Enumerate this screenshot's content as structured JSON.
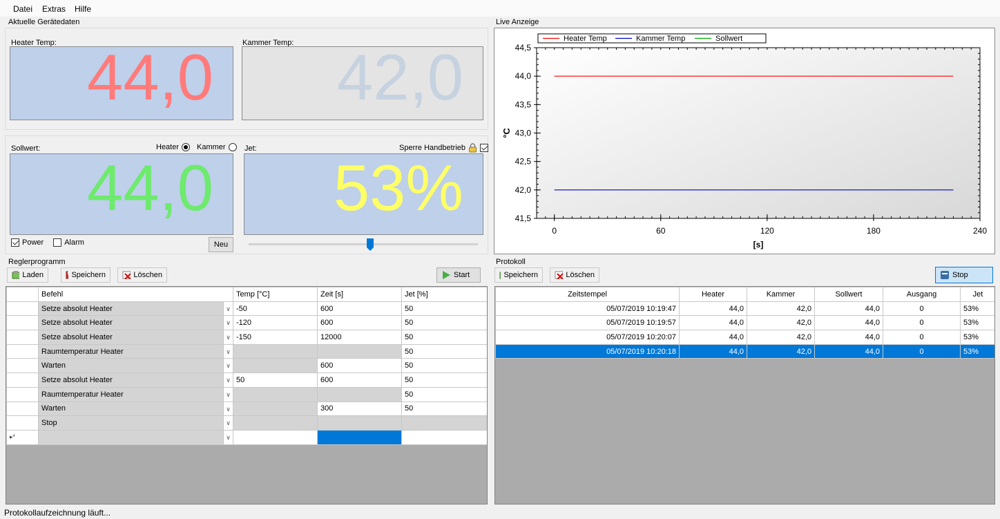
{
  "menu": [
    "Datei",
    "Extras",
    "Hilfe"
  ],
  "device": {
    "group_title": "Aktuelle Gerätedaten",
    "heater_label": "Heater Temp:",
    "heater_value": "44,0",
    "kammer_label": "Kammer Temp:",
    "kammer_value": "42,0",
    "sollwert_label": "Sollwert:",
    "sollwert_value": "44,0",
    "radio_heater": "Heater",
    "radio_kammer": "Kammer",
    "jet_label": "Jet:",
    "jet_value": "53%",
    "sperre_label": "Sperre Handbetrieb",
    "power_label": "Power",
    "alarm_label": "Alarm",
    "neu_label": "Neu",
    "jet_slider_value": 0.53
  },
  "colors": {
    "heater": "#ff7b7b",
    "kammer": "#c6d2e0",
    "sollwert": "#6eea6e",
    "jet": "#ffff66",
    "selection": "#0078d7"
  },
  "live": {
    "group_title": "Live Anzeige"
  },
  "chart_data": {
    "type": "line",
    "ylabel": "°C",
    "xlabel": "[s]",
    "ylim": [
      41.5,
      44.5
    ],
    "xlim": [
      -10,
      240
    ],
    "y_ticks": [
      "41,5",
      "42,0",
      "42,5",
      "43,0",
      "43,5",
      "44,0",
      "44,5"
    ],
    "x_ticks": [
      "0",
      "60",
      "120",
      "180",
      "240"
    ],
    "legend": "top-left",
    "series": [
      {
        "name": "Heater Temp",
        "color": "#ff0000",
        "x": [
          0,
          225
        ],
        "values": [
          44.0,
          44.0
        ]
      },
      {
        "name": "Kammer Temp",
        "color": "#0000cc",
        "x": [
          0,
          225
        ],
        "values": [
          42.0,
          42.0
        ]
      },
      {
        "name": "Sollwert",
        "color": "#00aa00",
        "x": [],
        "values": []
      }
    ]
  },
  "regler": {
    "group_title": "Reglerprogramm",
    "btn_laden": "Laden",
    "btn_speichern": "Speichern",
    "btn_loeschen": "Löschen",
    "btn_start": "Start",
    "columns": [
      "Befehl",
      "Temp [°C]",
      "Zeit [s]",
      "Jet [%]"
    ],
    "rows": [
      {
        "befehl": "Setze absolut Heater",
        "temp": "-50",
        "zeit": "600",
        "jet": "50"
      },
      {
        "befehl": "Setze absolut Heater",
        "temp": "-120",
        "zeit": "600",
        "jet": "50"
      },
      {
        "befehl": "Setze absolut Heater",
        "temp": "-150",
        "zeit": "12000",
        "jet": "50"
      },
      {
        "befehl": "Raumtemperatur Heater",
        "temp": "",
        "zeit": "",
        "jet": "50"
      },
      {
        "befehl": "Warten",
        "temp": "",
        "zeit": "600",
        "jet": "50"
      },
      {
        "befehl": "Setze absolut Heater",
        "temp": "50",
        "zeit": "600",
        "jet": "50"
      },
      {
        "befehl": "Raumtemperatur Heater",
        "temp": "",
        "zeit": "",
        "jet": "50"
      },
      {
        "befehl": "Warten",
        "temp": "",
        "zeit": "300",
        "jet": "50"
      },
      {
        "befehl": "Stop",
        "temp": "",
        "zeit": "",
        "jet": ""
      }
    ],
    "new_row_marker": "▸*"
  },
  "protokoll": {
    "group_title": "Protokoll",
    "btn_speichern": "Speichern",
    "btn_loeschen": "Löschen",
    "btn_stop": "Stop",
    "columns": [
      "Zeitstempel",
      "Heater",
      "Kammer",
      "Sollwert",
      "Ausgang",
      "Jet"
    ],
    "rows": [
      [
        "05/07/2019 10:19:47",
        "44,0",
        "42,0",
        "44,0",
        "0",
        "53%"
      ],
      [
        "05/07/2019 10:19:57",
        "44,0",
        "42,0",
        "44,0",
        "0",
        "53%"
      ],
      [
        "05/07/2019 10:20:07",
        "44,0",
        "42,0",
        "44,0",
        "0",
        "53%"
      ],
      [
        "05/07/2019 10:20:18",
        "44,0",
        "42,0",
        "44,0",
        "0",
        "53%"
      ]
    ],
    "selected_row": 3
  },
  "status": {
    "text": "Protokollaufzeichnung läuft..."
  }
}
